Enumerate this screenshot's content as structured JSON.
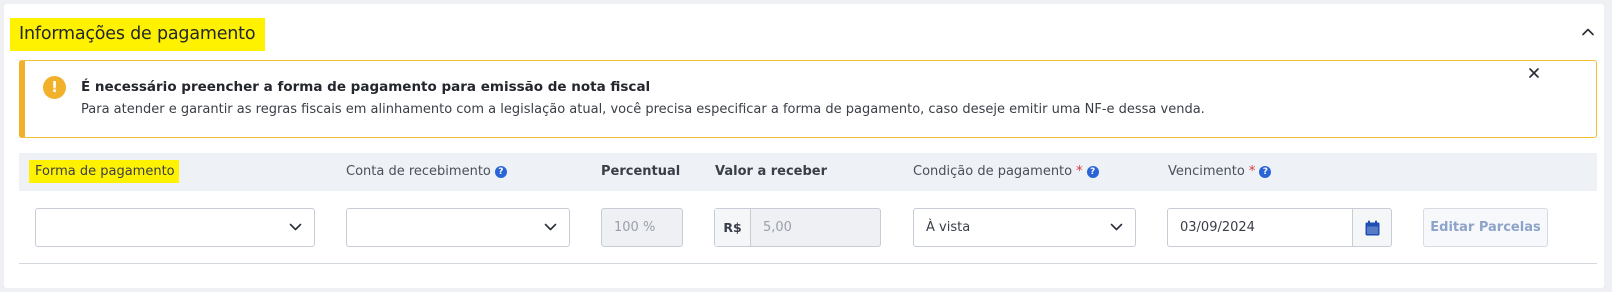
{
  "section": {
    "title": "Informações de pagamento"
  },
  "alert": {
    "icon": "exclamation-icon",
    "icon_glyph": "!",
    "title": "É necessário preencher a forma de pagamento para emissão de nota fiscal",
    "message": "Para atender e garantir as regras fiscais em alinhamento com a legislação atual, você precisa especificar a forma de pagamento, caso deseje emitir uma NF-e dessa venda.",
    "accent_color": "#f2b12b"
  },
  "table": {
    "headers": {
      "forma": "Forma de pagamento",
      "conta": "Conta de recebimento",
      "percentual": "Percentual",
      "valor": "Valor a receber",
      "condicao": "Condição de pagamento",
      "vencimento": "Vencimento",
      "required_mark": "*",
      "help_glyph": "?"
    },
    "row": {
      "forma_value": "",
      "conta_value": "",
      "percentual_value": "100 %",
      "currency_prefix": "R$",
      "valor_value": "5,00",
      "condicao_value": "À vista",
      "vencimento_value": "03/09/2024",
      "edit_button": "Editar Parcelas"
    }
  },
  "colors": {
    "highlight": "#fff200",
    "help_icon": "#2a64d6",
    "calendar_icon": "#1f4fb4",
    "required": "#d63a3a"
  }
}
